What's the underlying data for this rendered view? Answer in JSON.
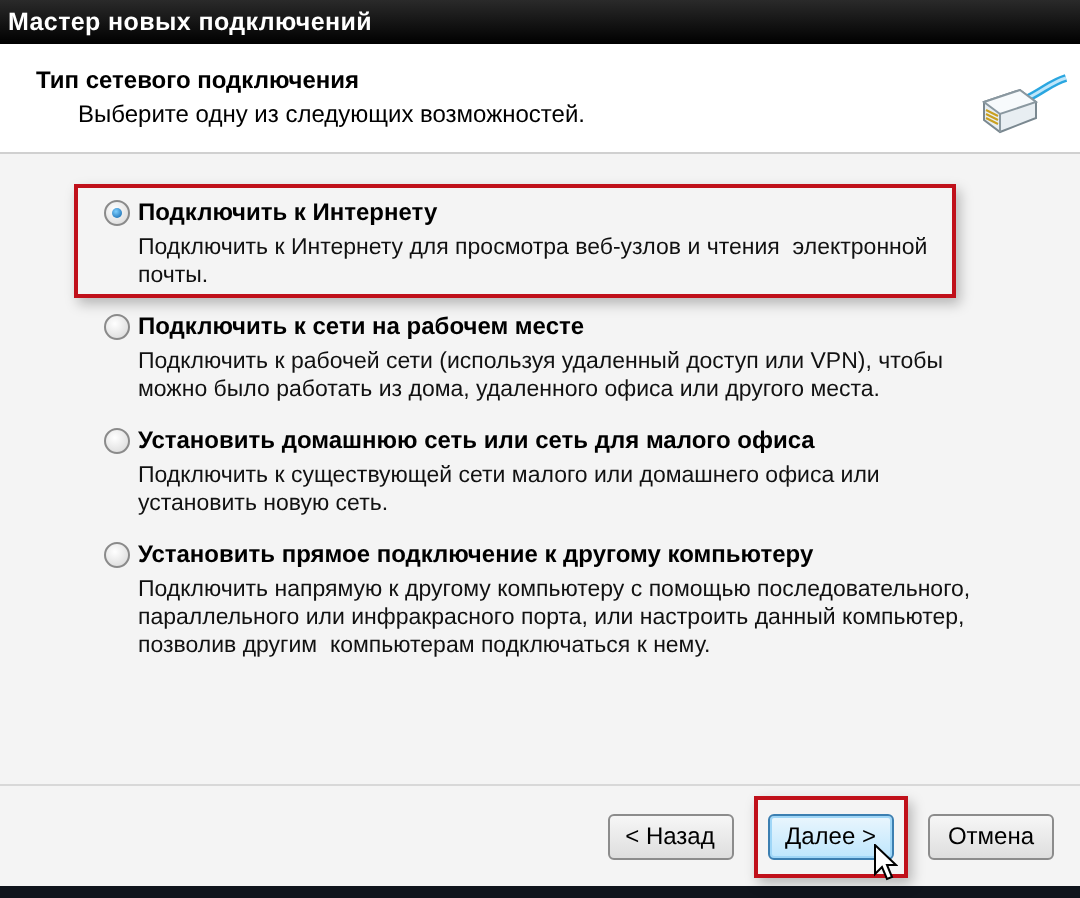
{
  "window": {
    "title": "Мастер новых подключений"
  },
  "header": {
    "title": "Тип сетевого подключения",
    "subtitle": "Выберите одну из следующих возможностей."
  },
  "options": [
    {
      "label": "Подключить к Интернету",
      "description": "Подключить к Интернету для просмотра веб-узлов и чтения  электронной\nпочты.",
      "selected": true,
      "highlighted": true
    },
    {
      "label": "Подключить к сети на рабочем месте",
      "description": "Подключить к рабочей сети (используя удаленный доступ или VPN), чтобы\nможно было работать из дома, удаленного офиса или другого места.",
      "selected": false,
      "highlighted": false
    },
    {
      "label": "Установить домашнюю сеть или сеть для малого офиса",
      "description": "Подключить к существующей сети малого или домашнего офиса или\nустановить новую сеть.",
      "selected": false,
      "highlighted": false
    },
    {
      "label": "Установить прямое подключение к другому компьютеру",
      "description": "Подключить напрямую к другому компьютеру с помощью последовательного,\nпараллельного или инфракрасного порта, или настроить данный компьютер,\nпозволив другим  компьютерам подключаться к нему.",
      "selected": false,
      "highlighted": false
    }
  ],
  "buttons": [
    {
      "label": "< Назад",
      "default": false,
      "highlighted": false
    },
    {
      "label": "Далее >",
      "default": true,
      "highlighted": true
    },
    {
      "label": "Отмена",
      "default": false,
      "highlighted": false
    }
  ]
}
